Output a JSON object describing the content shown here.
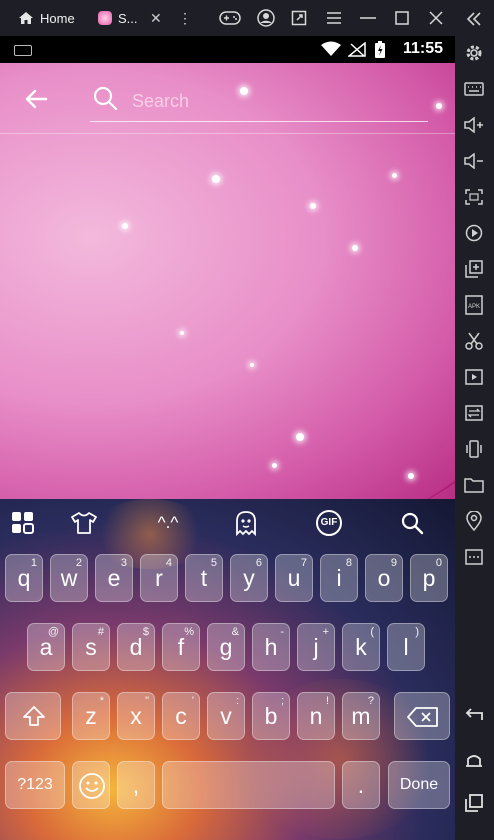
{
  "topbar": {
    "home_tab": "Home",
    "app_tab": "S...",
    "close_glyph": "✕"
  },
  "statusbar": {
    "time": "11:55"
  },
  "app": {
    "search_placeholder": "Search"
  },
  "keyboard": {
    "row1": [
      {
        "main": "q",
        "alt": "1"
      },
      {
        "main": "w",
        "alt": "2"
      },
      {
        "main": "e",
        "alt": "3"
      },
      {
        "main": "r",
        "alt": "4"
      },
      {
        "main": "t",
        "alt": "5"
      },
      {
        "main": "y",
        "alt": "6"
      },
      {
        "main": "u",
        "alt": "7"
      },
      {
        "main": "i",
        "alt": "8"
      },
      {
        "main": "o",
        "alt": "9"
      },
      {
        "main": "p",
        "alt": "0"
      }
    ],
    "row2": [
      {
        "main": "a",
        "alt": "@"
      },
      {
        "main": "s",
        "alt": "#"
      },
      {
        "main": "d",
        "alt": "$"
      },
      {
        "main": "f",
        "alt": "%"
      },
      {
        "main": "g",
        "alt": "&"
      },
      {
        "main": "h",
        "alt": "-"
      },
      {
        "main": "j",
        "alt": "+"
      },
      {
        "main": "k",
        "alt": "("
      },
      {
        "main": "l",
        "alt": ")"
      }
    ],
    "row3": [
      {
        "main": "z",
        "alt": "*"
      },
      {
        "main": "x",
        "alt": "\""
      },
      {
        "main": "c",
        "alt": "'"
      },
      {
        "main": "v",
        "alt": ":"
      },
      {
        "main": "b",
        "alt": ";"
      },
      {
        "main": "n",
        "alt": "!"
      },
      {
        "main": "m",
        "alt": "?"
      }
    ],
    "symbols_label": "?123",
    "comma_label": ",",
    "period_label": ".",
    "done_label": "Done",
    "emoticon_label": "^.^",
    "gif_label": "GIF"
  },
  "colors": {
    "app_pink": "#e88ec8",
    "emulator_bar": "#1e1f26"
  }
}
